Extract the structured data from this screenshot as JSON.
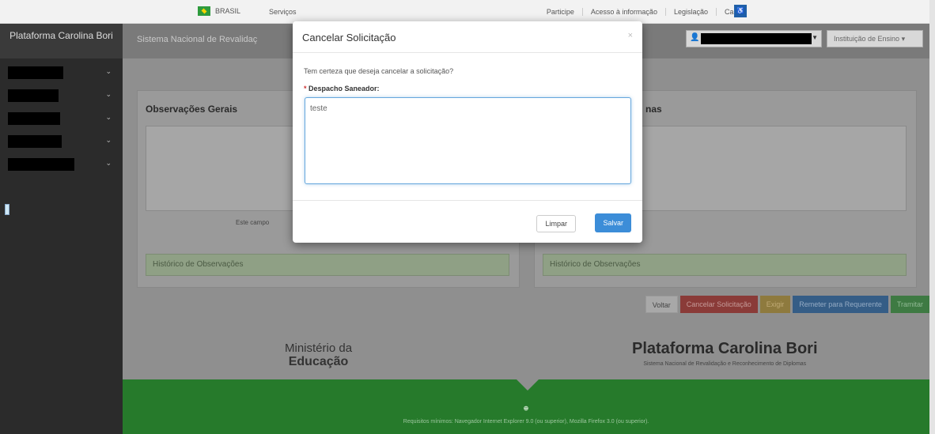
{
  "govbar": {
    "brasil_label": "BRASIL",
    "servicos_label": "Serviços",
    "links": [
      "Participe",
      "Acesso à informação",
      "Legislação",
      "Canais"
    ]
  },
  "sidebar": {
    "brand": "Plataforma Carolina Bori",
    "items": [
      {
        "label": "[redacted]"
      },
      {
        "label": "[redacted]"
      },
      {
        "label": "[redacted]"
      },
      {
        "label": "[redacted]"
      },
      {
        "label": "[redacted]"
      }
    ]
  },
  "header": {
    "title": "Sistema Nacional de Revalidaç",
    "institution_label": "Instituição de Ensino"
  },
  "main": {
    "panel_left": {
      "title": "Observações Gerais",
      "hint": "Este campo",
      "history": "Histórico de Observações"
    },
    "panel_right": {
      "title": "nas",
      "history": "Histórico de Observações"
    },
    "actions": {
      "voltar": "Voltar",
      "cancelar": "Cancelar Solicitação",
      "yellow": "Exigir",
      "blue": "Remeter para Requerente",
      "green": "Tramitar"
    }
  },
  "footer": {
    "mec_line1": "Ministério da",
    "mec_line2": "Educação",
    "bori_title": "Plataforma Carolina Bori",
    "bori_subtitle": "Sistema Nacional de Revalidação e Reconhecimento de Diplomas",
    "requirements": "Requisitos mínimos: Navegador Internet Explorer 9.0 (ou superior), Mozilla Firefox 3.0 (ou superior)."
  },
  "modal": {
    "title": "Cancelar Solicitação",
    "close_symbol": "×",
    "question": "Tem certeza que deseja cancelar a solicitação?",
    "required_mark": "*",
    "field_label": "Despacho Saneador:",
    "field_value": "teste",
    "limpar_label": "Limpar",
    "salvar_label": "Salvar"
  }
}
